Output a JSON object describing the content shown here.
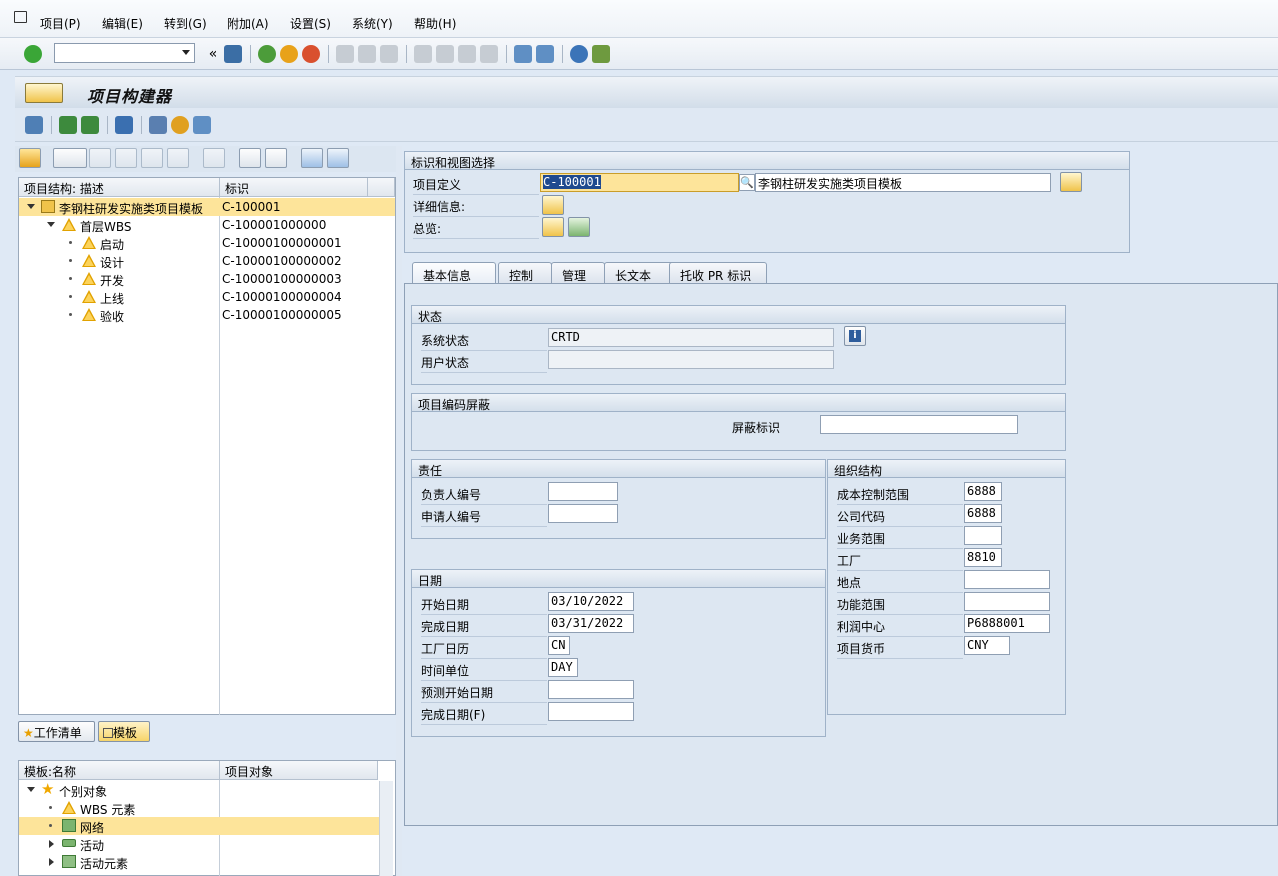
{
  "menu": {
    "items": [
      "项目(P)",
      "编辑(E)",
      "转到(G)",
      "附加(A)",
      "设置(S)",
      "系统(Y)",
      "帮助(H)"
    ]
  },
  "toolbar": {
    "command_field": ""
  },
  "title": "项目构建器",
  "tree": {
    "col1": "项目结构: 描述",
    "col2": "标识",
    "rows": [
      {
        "desc": "李钢柱研发实施类项目模板",
        "id": "C-100001"
      },
      {
        "desc": "首层WBS",
        "id": "C-100001000000"
      },
      {
        "desc": "启动",
        "id": "C-10000100000001"
      },
      {
        "desc": "设计",
        "id": "C-10000100000002"
      },
      {
        "desc": "开发",
        "id": "C-10000100000003"
      },
      {
        "desc": "上线",
        "id": "C-10000100000004"
      },
      {
        "desc": "验收",
        "id": "C-10000100000005"
      }
    ]
  },
  "left_tabs": {
    "worklist": "工作清单",
    "template": "模板"
  },
  "templates": {
    "col1": "模板:名称",
    "col2": "项目对象",
    "rows": [
      "个别对象",
      "WBS 元素",
      "网络",
      "活动",
      "活动元素"
    ]
  },
  "ident": {
    "title": "标识和视图选择",
    "project_def_label": "项目定义",
    "project_def_value": "C-100001",
    "project_desc": "李钢柱研发实施类项目模板",
    "detail_label": "详细信息:",
    "overview_label": "总览:"
  },
  "tabs": [
    "基本信息",
    "控制",
    "管理",
    "长文本",
    "托收 PR 标识"
  ],
  "status": {
    "title": "状态",
    "sys_label": "系统状态",
    "sys_value": "CRTD",
    "user_label": "用户状态",
    "user_value": ""
  },
  "mask": {
    "title": "项目编码屏蔽",
    "label": "屏蔽标识",
    "value": ""
  },
  "resp": {
    "title": "责任",
    "person_label": "负责人编号",
    "person_value": "",
    "applicant_label": "申请人编号",
    "applicant_value": ""
  },
  "org": {
    "title": "组织结构",
    "fields": [
      {
        "label": "成本控制范围",
        "value": "6888"
      },
      {
        "label": "公司代码",
        "value": "6888"
      },
      {
        "label": "业务范围",
        "value": ""
      },
      {
        "label": "工厂",
        "value": "8810"
      },
      {
        "label": "地点",
        "value": ""
      },
      {
        "label": "功能范围",
        "value": ""
      },
      {
        "label": "利润中心",
        "value": "P6888001"
      },
      {
        "label": "项目货币",
        "value": "CNY"
      }
    ]
  },
  "dates": {
    "title": "日期",
    "fields": [
      {
        "label": "开始日期",
        "value": "03/10/2022"
      },
      {
        "label": "完成日期",
        "value": "03/31/2022"
      },
      {
        "label": "工厂日历",
        "value": "CN"
      },
      {
        "label": "时间单位",
        "value": "DAY"
      },
      {
        "label": "预测开始日期",
        "value": ""
      },
      {
        "label": "完成日期(F)",
        "value": ""
      }
    ]
  },
  "colors": {
    "accent": "#fde49a",
    "panel": "#dde7f2"
  }
}
